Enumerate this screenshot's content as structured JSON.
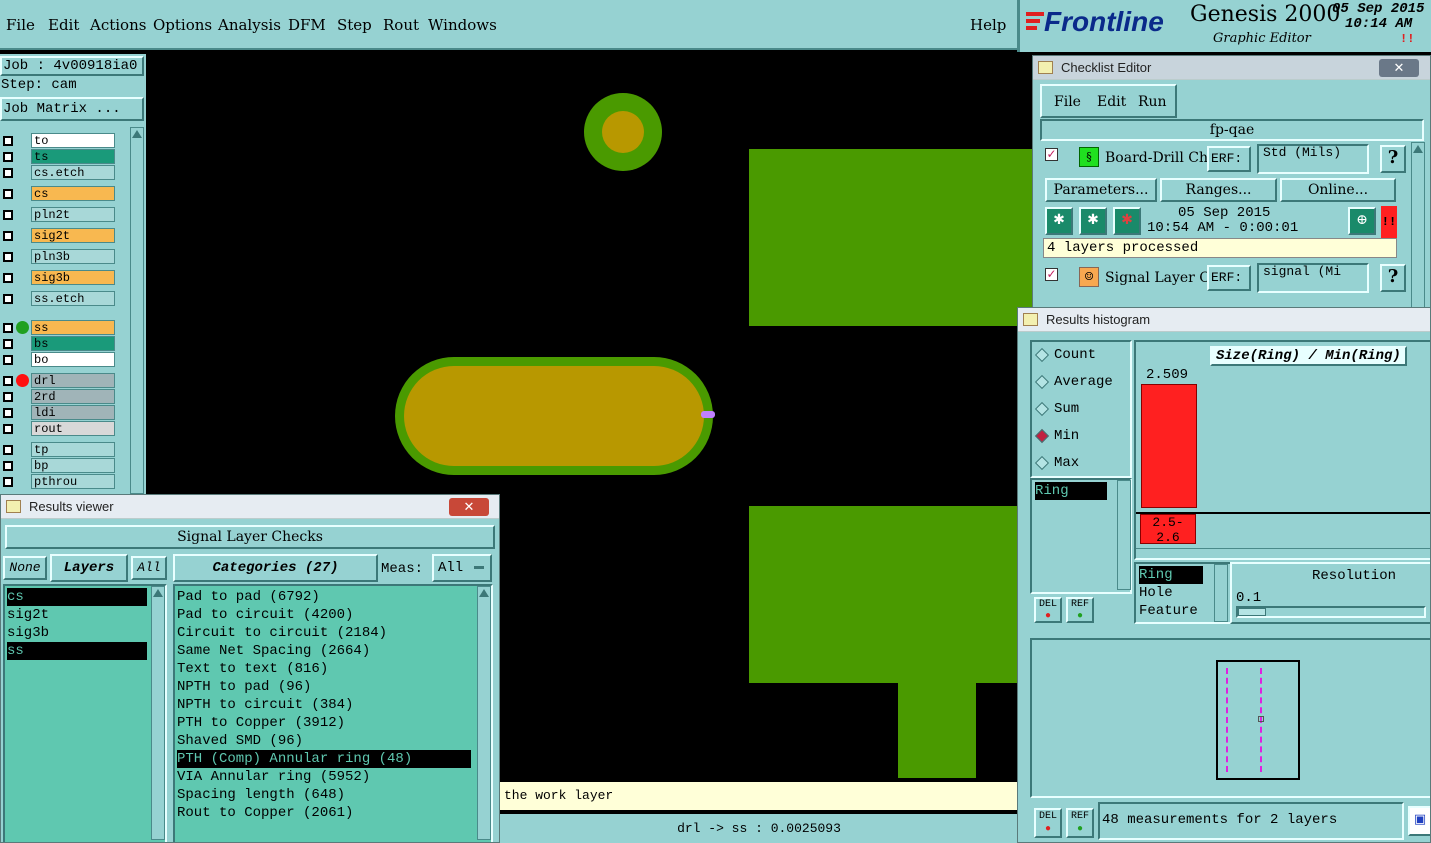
{
  "menu": {
    "items": [
      "File",
      "Edit",
      "Actions",
      "Options",
      "Analysis",
      "DFM",
      "Step",
      "Rout",
      "Windows"
    ],
    "help": "Help"
  },
  "brand": {
    "logo": "Frontline",
    "product": "Genesis 2000",
    "subtitle": "Graphic Editor",
    "date": "05 Sep 2015",
    "time": "10:14 AM",
    "alert": "!!"
  },
  "left_panel": {
    "job": "Job : 4v00918ia0",
    "step": "Step: cam",
    "job_matrix": "Job Matrix ...",
    "layers": [
      {
        "name": "to",
        "color": "#ffffff"
      },
      {
        "name": "ts",
        "color": "#1a9a7a"
      },
      {
        "name": "cs.etch",
        "color": "#a8d8d8"
      },
      {
        "name": "cs",
        "color": "#f8b850"
      },
      {
        "name": "pln2t",
        "color": "#a8d8d8"
      },
      {
        "name": "sig2t",
        "color": "#f8b850"
      },
      {
        "name": "pln3b",
        "color": "#a8d8d8"
      },
      {
        "name": "sig3b",
        "color": "#f8b850"
      },
      {
        "name": "ss.etch",
        "color": "#a8d8d8"
      },
      {
        "name": "ss",
        "color": "#f8b850"
      },
      {
        "name": "bs",
        "color": "#1a9a7a"
      },
      {
        "name": "bo",
        "color": "#ffffff"
      },
      {
        "name": "drl",
        "color": "#a0b4b8"
      },
      {
        "name": "2rd",
        "color": "#a0b4b8"
      },
      {
        "name": "ldi",
        "color": "#a0b4b8"
      },
      {
        "name": "rout",
        "color": "#d8d8d8"
      },
      {
        "name": "tp",
        "color": "#a8d8d8"
      },
      {
        "name": "bp",
        "color": "#a8d8d8"
      },
      {
        "name": "pthrou",
        "color": "#a8d8d8"
      }
    ]
  },
  "canvas": {
    "status_message": "the work layer",
    "measure_readout": "drl -> ss : 0.0025093",
    "colors": {
      "copper": "#4a9a00",
      "pad": "#b89800",
      "background": "#000000",
      "marker": "#c080ff"
    }
  },
  "checklist_editor": {
    "title": "Checklist Editor",
    "menu": [
      "File",
      "Edit",
      "Run"
    ],
    "checklist_name": "fp-qae",
    "checks": [
      {
        "name": "Board-Drill Che",
        "erf": "ERF:",
        "erf_value": "Std (Mils)",
        "help": "?",
        "params": "Parameters...",
        "ranges": "Ranges...",
        "online": "Online...",
        "date": "05 Sep 2015",
        "time": "10:54 AM - 0:00:01",
        "status": "4 layers processed",
        "alert": "!!"
      },
      {
        "name": "Signal Layer Ch",
        "erf": "ERF:",
        "erf_value": "signal (Mi",
        "help": "?"
      }
    ],
    "close": "✕"
  },
  "results_histogram": {
    "title": "Results histogram",
    "modes": [
      {
        "label": "Count",
        "selected": false
      },
      {
        "label": "Average",
        "selected": false
      },
      {
        "label": "Sum",
        "selected": false
      },
      {
        "label": "Min",
        "selected": true
      },
      {
        "label": "Max",
        "selected": false
      }
    ],
    "list_items": [
      "Ring"
    ],
    "chart_title": "Size(Ring) / Min(Ring)",
    "bar_value": "2.509",
    "bin_label": "2.5-2.6",
    "axes": [
      "Ring",
      "Hole",
      "Feature"
    ],
    "resolution_label": "Resolution",
    "resolution_value": "0.1",
    "del_label": "DEL",
    "ref_label": "REF",
    "summary": "48 measurements for 2 layers",
    "bar_color": "#ff2020"
  },
  "results_viewer": {
    "title": "Results viewer",
    "heading": "Signal Layer Checks",
    "tabs": {
      "none": "None",
      "layers": "Layers",
      "all": "All"
    },
    "layers": [
      {
        "name": "cs",
        "selected": true
      },
      {
        "name": "sig2t",
        "selected": false
      },
      {
        "name": "sig3b",
        "selected": false
      },
      {
        "name": "ss",
        "selected": true
      }
    ],
    "categories_label": "Categories (27)",
    "meas_label": "Meas:",
    "meas_value": "All",
    "categories": [
      {
        "text": "Pad to pad (6792)",
        "selected": false
      },
      {
        "text": "Pad to circuit (4200)",
        "selected": false
      },
      {
        "text": "Circuit to circuit (2184)",
        "selected": false
      },
      {
        "text": "Same Net Spacing (2664)",
        "selected": false
      },
      {
        "text": "Text to text (816)",
        "selected": false
      },
      {
        "text": "NPTH to pad (96)",
        "selected": false
      },
      {
        "text": "NPTH to circuit (384)",
        "selected": false
      },
      {
        "text": "PTH to Copper (3912)",
        "selected": false
      },
      {
        "text": "Shaved SMD (96)",
        "selected": false
      },
      {
        "text": "PTH (Comp) Annular ring (48)",
        "selected": true
      },
      {
        "text": "VIA Annular ring (5952)",
        "selected": false
      },
      {
        "text": "Spacing length (648)",
        "selected": false
      },
      {
        "text": "Rout to Copper (2061)",
        "selected": false
      }
    ]
  }
}
